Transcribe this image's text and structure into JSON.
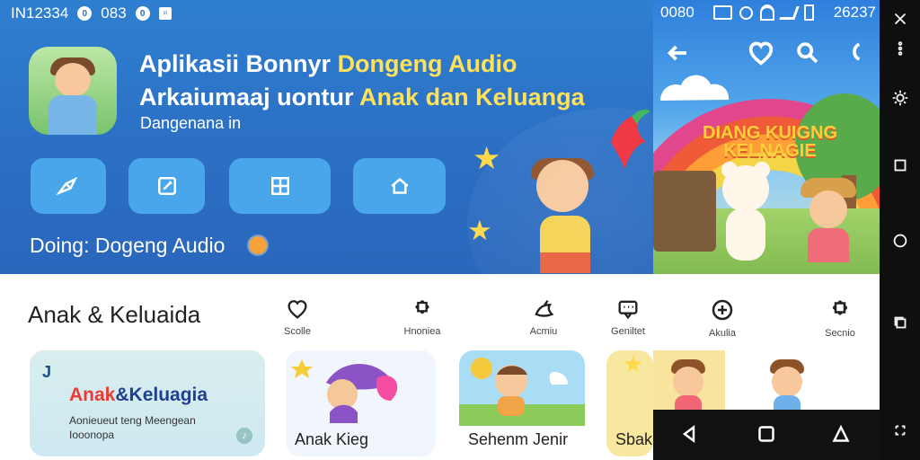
{
  "left_panel": {
    "status_bar": {
      "left_text": "IN12334",
      "icon_1": "0",
      "time_text": "083",
      "icon_2": "0",
      "icon_3": "sl"
    },
    "header": {
      "title_line_1_white": "Aplikasii Bonnyr ",
      "title_line_1_yellow": "Dongeng Audio",
      "title_line_2_white": "Arkaiumaaj uontur ",
      "title_line_2_yellow": "Anak dan Keluanga",
      "subtitle": "Dangenana in"
    },
    "now_playing": "Doing: Dogeng Audio",
    "section_title": "Anak & Keluaida",
    "nav_items": [
      {
        "label": "Scolle"
      },
      {
        "label": "Hnoniea"
      },
      {
        "label": "Acmiu"
      },
      {
        "label": "Geniltet"
      }
    ],
    "cards": {
      "featured": {
        "corner_text": "J",
        "headline_red": "Anak",
        "headline_blue": "&Keluagia",
        "description": "Aonieueut teng Meengean Iooonopa"
      },
      "card_2": {
        "label": "Anak Kieg"
      },
      "card_3": {
        "label": "Sehenm Jenir"
      },
      "card_4": {
        "label": "Sbak"
      }
    }
  },
  "right_panel": {
    "status_bar": {
      "left_text": "0080",
      "right_text": "26237"
    },
    "scene_title": "DIANG KUIGNG KELNAGIE",
    "nav_items": [
      {
        "label": "Akulia"
      },
      {
        "label": "Secnio"
      }
    ]
  },
  "colors": {
    "hero_blue": "#2b6fc4",
    "accent_yellow": "#ffe15a",
    "button_blue": "#4aa6ea"
  }
}
